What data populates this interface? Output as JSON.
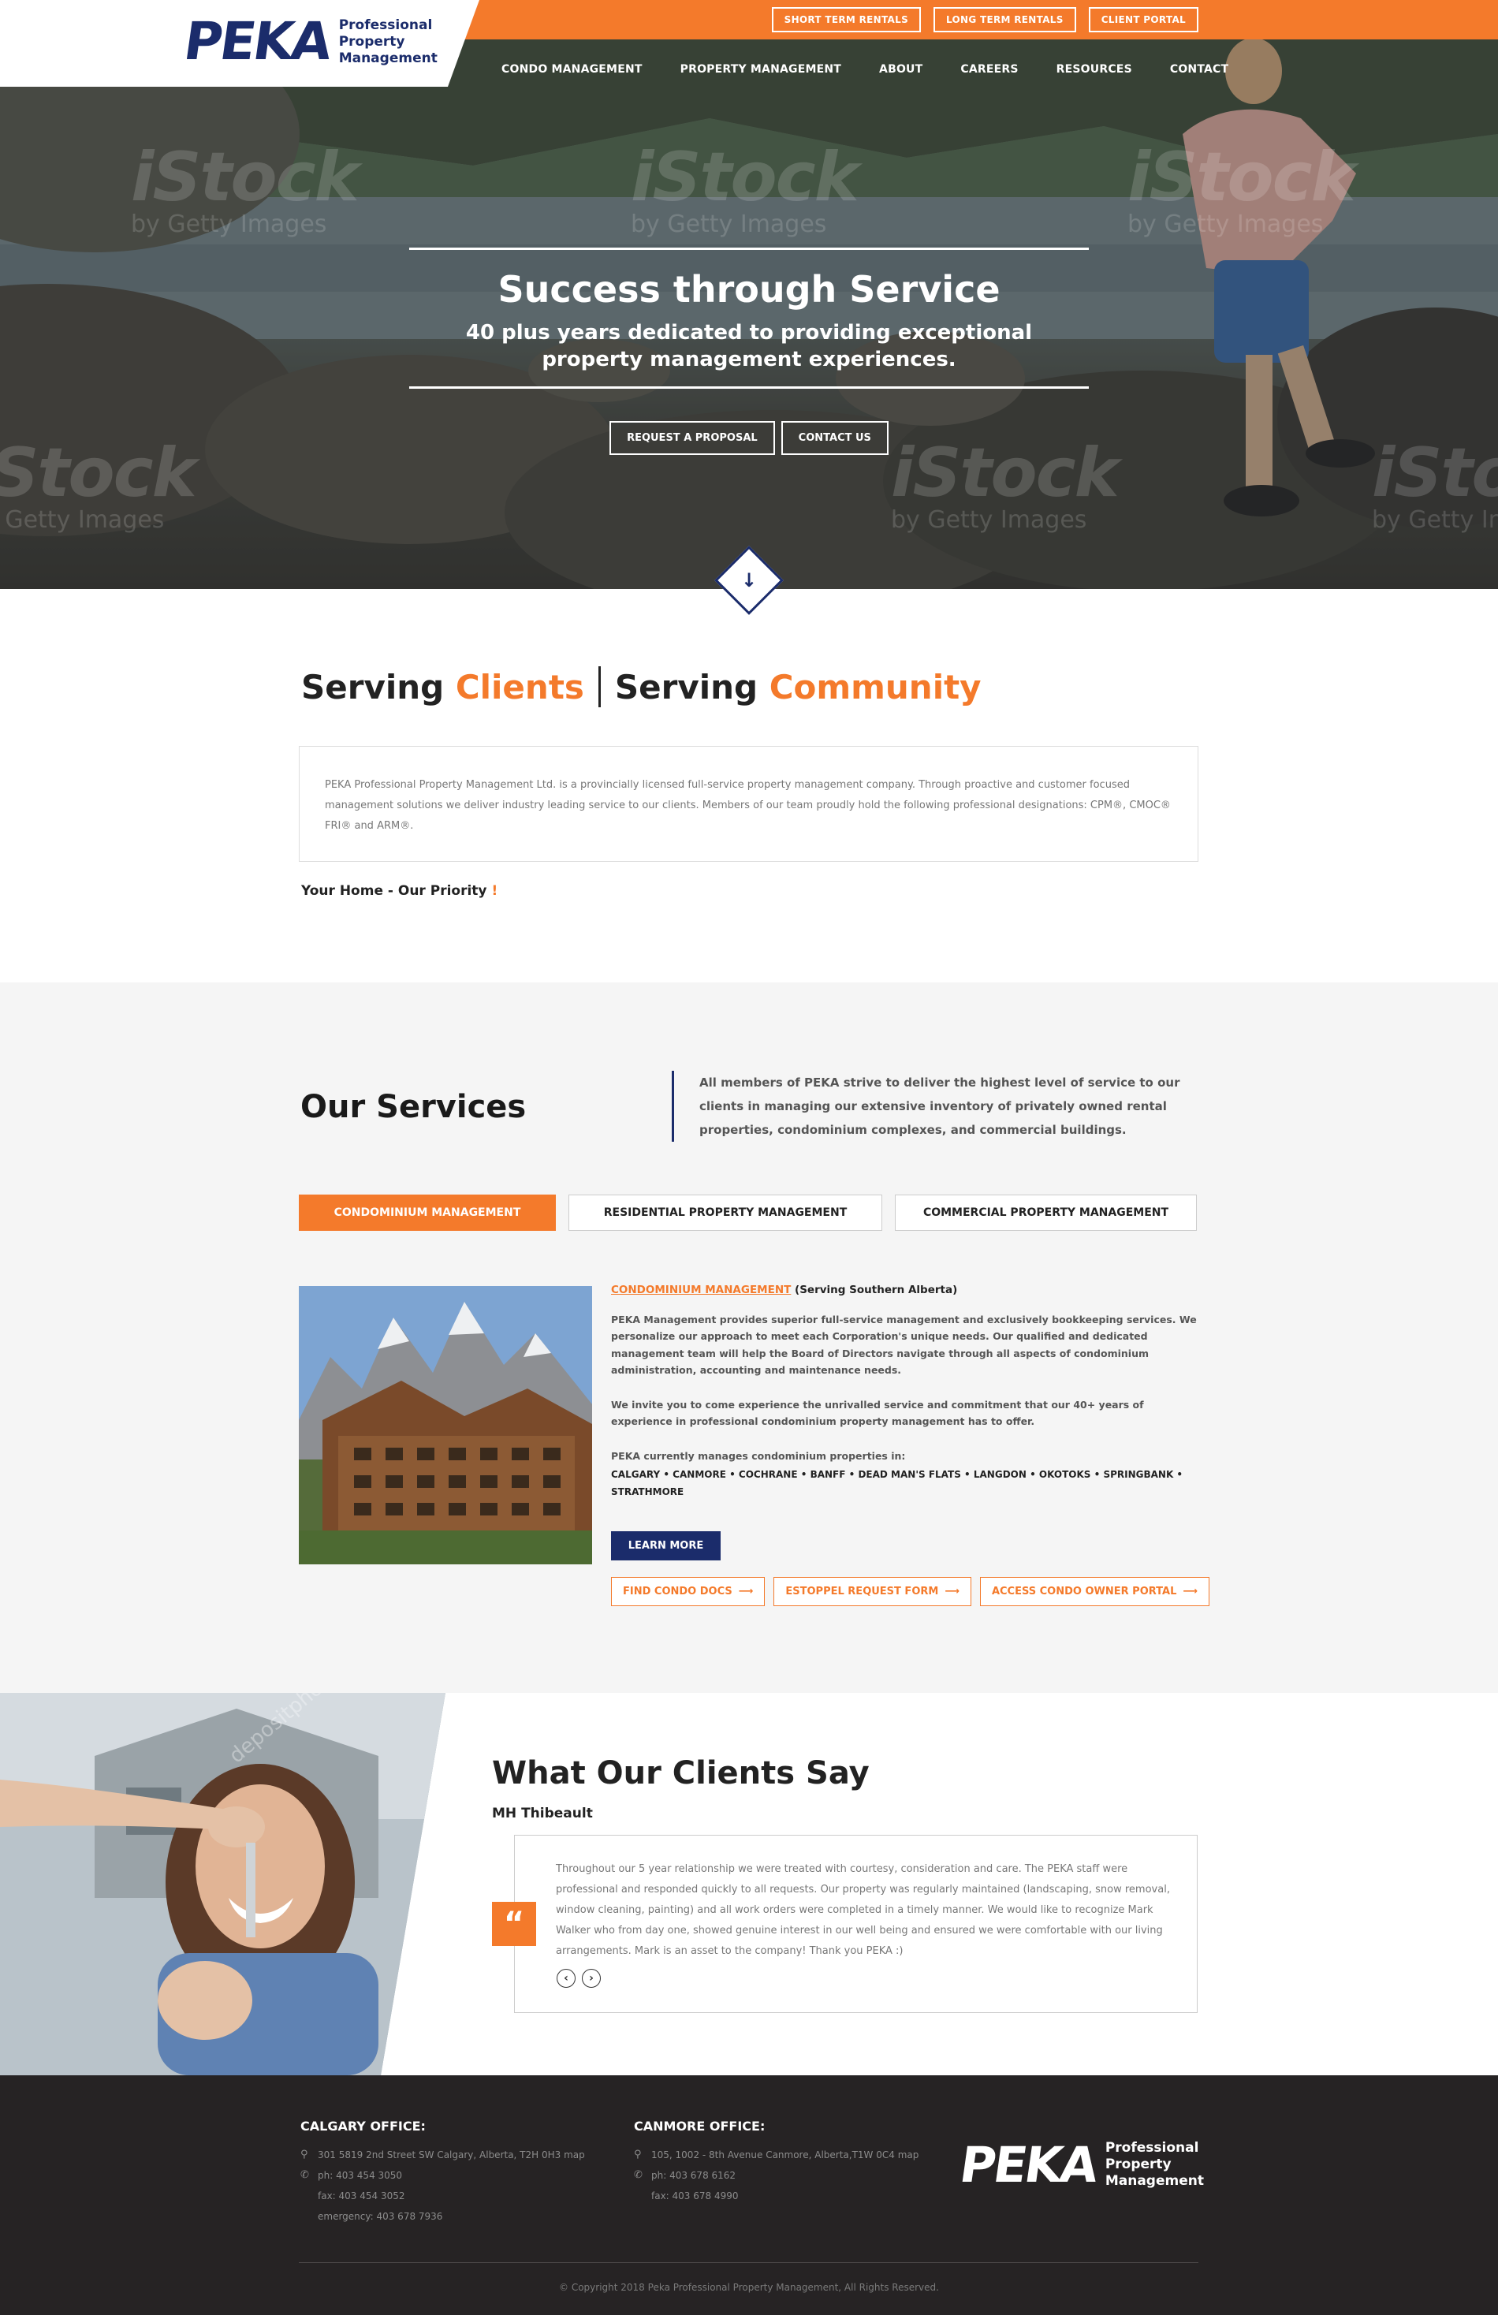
{
  "brand": {
    "logo_word": "PEKA",
    "logo_sub_line1": "Professional",
    "logo_sub_line2": "Property",
    "logo_sub_line3": "Management",
    "colors": {
      "orange": "#f47a2b",
      "navy": "#1b2c6b",
      "footer_bg": "#262324"
    }
  },
  "top_links": [
    "SHORT TERM RENTALS",
    "LONG TERM RENTALS",
    "CLIENT PORTAL"
  ],
  "nav": [
    "CONDO MANAGEMENT",
    "PROPERTY MANAGEMENT",
    "ABOUT",
    "CAREERS",
    "RESOURCES",
    "CONTACT"
  ],
  "hero": {
    "title": "Success through Service",
    "subtitle": "40 plus years dedicated to providing exceptional property management experiences.",
    "btn_proposal": "REQUEST A PROPOSAL",
    "btn_contact": "CONTACT US",
    "watermark_word": "iStock",
    "watermark_sub": "by Getty Images",
    "down_icon": "arrow-down-icon"
  },
  "serving": {
    "part1": "Serving",
    "part2": "Clients",
    "part3": "Serving",
    "part4": "Community"
  },
  "intro": {
    "text": "PEKA Professional Property Management Ltd. is a provincially licensed full-service property management company.  Through proactive and customer focused management solutions we deliver industry leading service to our clients.  Members of our team proudly hold the following professional designations: CPM®, CMOC® FRI® and ARM®.",
    "tagline": "Your Home - Our Priority",
    "tagline_mark": "!"
  },
  "services": {
    "title": "Our Services",
    "note": "All members of PEKA strive to deliver the highest level of service to our clients in managing our extensive inventory of privately owned rental properties, condominium complexes, and commercial buildings.",
    "tabs": [
      "CONDOMINIUM MANAGEMENT",
      "RESIDENTIAL PROPERTY MANAGEMENT",
      "COMMERCIAL PROPERTY MANAGEMENT"
    ],
    "head_link": "CONDOMINIUM MANAGEMENT",
    "head_rest": " (Serving Southern Alberta)",
    "para1": "PEKA Management provides superior full-service management and exclusively bookkeeping services. We personalize our approach to meet each Corporation's unique needs. Our qualified and dedicated management team will help the Board of Directors navigate through all aspects of condominium administration, accounting and maintenance needs.",
    "para2": "We invite you to come experience the unrivalled service and commitment that our 40+ years of experience in professional condominium property management has to offer.",
    "para3": "PEKA currently manages condominium properties in:",
    "cities": "CALGARY • CANMORE • COCHRANE • BANFF • DEAD MAN'S FLATS • LANGDON • OKOTOKS • SPRINGBANK • STRATHMORE",
    "learn_more": "LEARN MORE",
    "links": [
      "FIND CONDO DOCS",
      "ESTOPPEL REQUEST FORM",
      "ACCESS CONDO OWNER PORTAL"
    ],
    "link_icon": "arrow-right-icon"
  },
  "testimonial": {
    "title": "What Our Clients Say",
    "name": "MH Thibeault",
    "quote": "Throughout our 5 year relationship we were treated with courtesy, consideration and care. The PEKA staff were professional and responded quickly to all requests. Our property was regularly maintained (landscaping, snow removal, window cleaning, painting) and all work orders were completed in a timely manner. We would like to recognize Mark Walker who from day one, showed genuine interest in our well being and ensured we were comfortable with our living arrangements. Mark is an asset to the company! Thank you PEKA :)",
    "quote_mark": "“",
    "prev": "‹",
    "next": "›",
    "watermark": "depositphotos"
  },
  "footer": {
    "calgary_title": "CALGARY OFFICE:",
    "calgary_address": "301 5819 2nd Street SW Calgary, Alberta, T2H 0H3 map",
    "calgary_ph": "ph: 403 454 3050",
    "calgary_fax": "fax: 403 454 3052",
    "calgary_emergency": "emergency: 403 678 7936",
    "canmore_title": "CANMORE OFFICE:",
    "canmore_address": "105, 1002 - 8th Avenue Canmore, Alberta,T1W 0C4 map",
    "canmore_ph": "ph: 403 678 6162",
    "canmore_fax": "fax: 403 678 4990",
    "copyright": "© Copyright 2018 Peka Professional Property Management, All Rights Reserved."
  }
}
